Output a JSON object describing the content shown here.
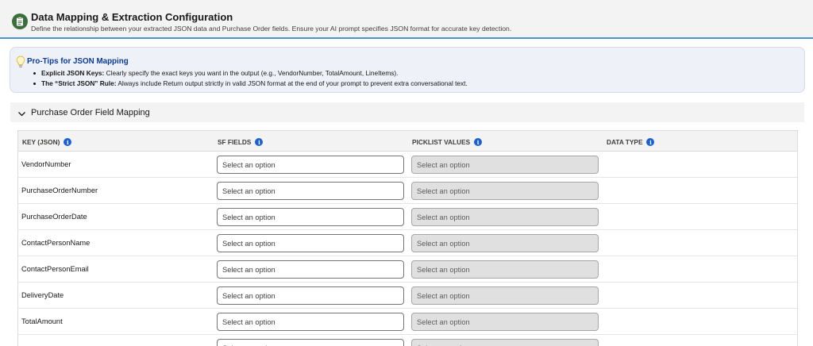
{
  "header": {
    "title": "Data Mapping & Extraction Configuration",
    "subtitle": "Define the relationship between your extracted JSON data and Purchase Order fields. Ensure your AI prompt specifies JSON format for accurate key detection."
  },
  "tips": {
    "title": "Pro-Tips for JSON Mapping",
    "items": [
      {
        "bold": "Explicit JSON Keys:",
        "text": " Clearly specify the exact keys you want in the output (e.g., VendorNumber, TotalAmount, LineItems)."
      },
      {
        "bold": "The “Strict JSON” Rule:",
        "text": " Always include Return output strictly in valid JSON format at the end of your prompt to prevent extra conversational text."
      }
    ]
  },
  "section": {
    "title": "Purchase Order Field Mapping"
  },
  "table": {
    "headers": [
      "KEY (JSON)",
      "SF FIELDS",
      "PICKLIST VALUES",
      "DATA TYPE"
    ],
    "select_placeholder": "Select an option",
    "rows": [
      {
        "key": "VendorNumber",
        "sf_field": "Select an option",
        "picklist": "Select an option"
      },
      {
        "key": "PurchaseOrderNumber",
        "sf_field": "Select an option",
        "picklist": "Select an option"
      },
      {
        "key": "PurchaseOrderDate",
        "sf_field": "Select an option",
        "picklist": "Select an option"
      },
      {
        "key": "ContactPersonName",
        "sf_field": "Select an option",
        "picklist": "Select an option"
      },
      {
        "key": "ContactPersonEmail",
        "sf_field": "Select an option",
        "picklist": "Select an option"
      },
      {
        "key": "DeliveryDate",
        "sf_field": "Select an option",
        "picklist": "Select an option"
      },
      {
        "key": "TotalAmount",
        "sf_field": "Select an option",
        "picklist": "Select an option"
      },
      {
        "key": "",
        "sf_field": "Select an option",
        "picklist": "Select an option"
      }
    ]
  },
  "colors": {
    "accent": "#1b5fd6",
    "header_rule": "#4f8fd6",
    "tips_title": "#0b3c99"
  },
  "icons": {
    "header": "clipboard-icon",
    "tips": "lightbulb-icon",
    "section": "chevron-down-icon",
    "column_help": "info-icon"
  }
}
